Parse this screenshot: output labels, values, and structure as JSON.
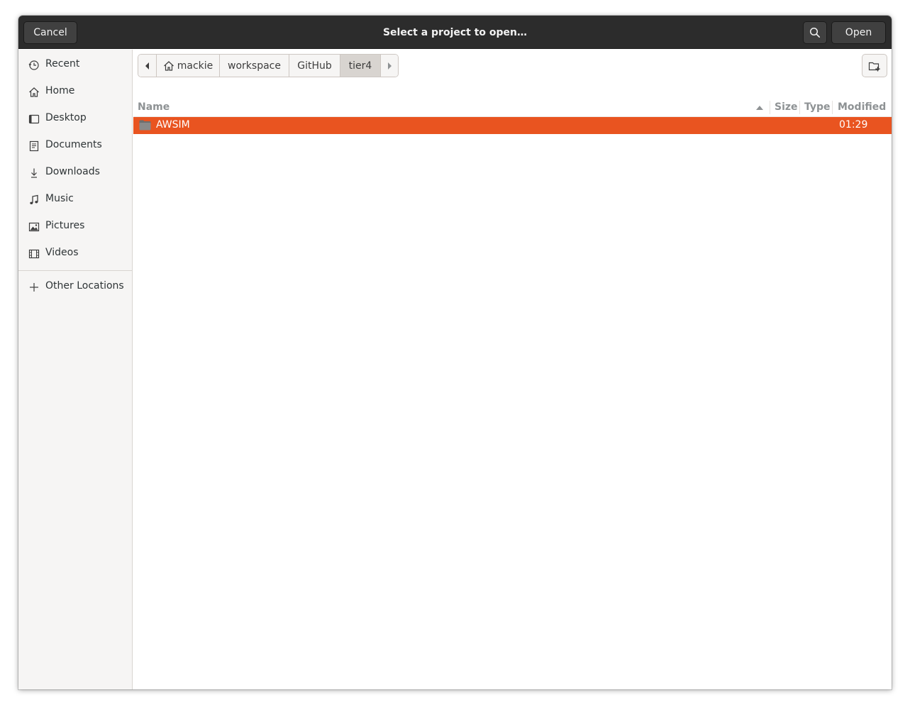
{
  "header": {
    "title": "Select a project to open…",
    "cancel_label": "Cancel",
    "open_label": "Open"
  },
  "sidebar": {
    "items": [
      {
        "label": "Recent",
        "icon": "clock-icon"
      },
      {
        "label": "Home",
        "icon": "home-icon"
      },
      {
        "label": "Desktop",
        "icon": "desktop-icon"
      },
      {
        "label": "Documents",
        "icon": "document-icon"
      },
      {
        "label": "Downloads",
        "icon": "download-icon"
      },
      {
        "label": "Music",
        "icon": "music-note-icon"
      },
      {
        "label": "Pictures",
        "icon": "picture-icon"
      },
      {
        "label": "Videos",
        "icon": "film-icon"
      }
    ],
    "other_locations": {
      "label": "Other Locations",
      "icon": "plus-icon"
    }
  },
  "pathbar": {
    "segments": [
      "mackie",
      "workspace",
      "GitHub",
      "tier4"
    ],
    "active": "tier4"
  },
  "columns": {
    "name": "Name",
    "size": "Size",
    "type": "Type",
    "modified": "Modified"
  },
  "files": [
    {
      "name": "AWSIM",
      "size": "",
      "type": "",
      "modified": "01:29",
      "selected": true,
      "icon": "folder-icon"
    }
  ],
  "colors": {
    "selection": "#e95420",
    "headerbar": "#2c2c2c",
    "sidebar": "#f6f5f4"
  }
}
